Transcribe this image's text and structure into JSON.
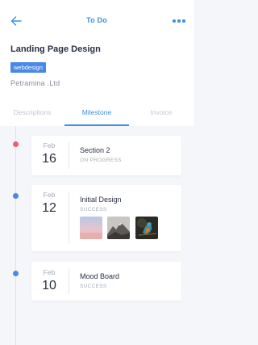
{
  "header": {
    "title": "To Do",
    "back_icon": "arrow-left-icon",
    "menu_icon": "more-horizontal-icon",
    "accent": "#3d8fe0"
  },
  "project": {
    "title": "Landing Page Design",
    "tag": "webdesign",
    "company": "Petramina .Ltd"
  },
  "tabs": [
    {
      "label": "Descriptions",
      "active": false
    },
    {
      "label": "Milestone",
      "active": true
    },
    {
      "label": "Invoice",
      "active": false
    }
  ],
  "milestones": [
    {
      "month": "Feb",
      "day": "16",
      "name": "Section 2",
      "status": "ON PROGRESS",
      "dot_color": "#f25b72"
    },
    {
      "month": "Feb",
      "day": "12",
      "name": "Initial Design",
      "status": "SUCCESS",
      "dot_color": "#4a88e8",
      "thumbnails": [
        "sunset-gradient-image",
        "mountain-image",
        "kingfisher-bird-image"
      ]
    },
    {
      "month": "Feb",
      "day": "10",
      "name": "Mood Board",
      "status": "SUCCESS",
      "dot_color": "#4a88e8"
    }
  ]
}
